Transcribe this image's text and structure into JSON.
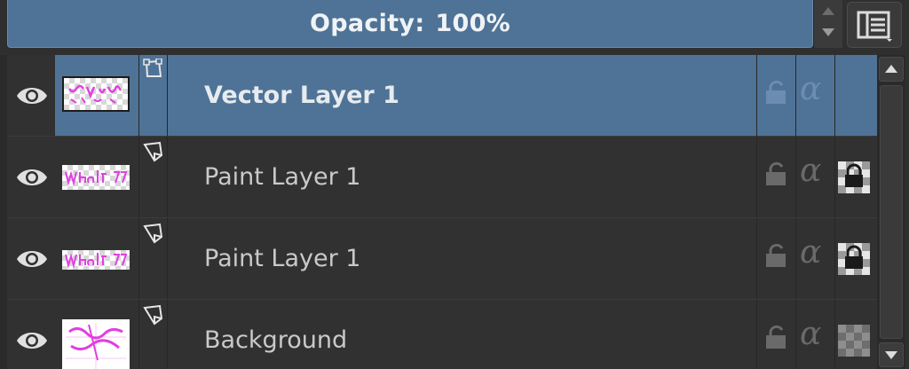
{
  "opacity": {
    "label": "Opacity:",
    "value": "100%"
  },
  "layers": [
    {
      "name": "Vector Layer 1",
      "type": "vector",
      "selected": true,
      "visible": true,
      "thumbnail": "pink-pattern"
    },
    {
      "name": "Paint Layer 1",
      "type": "paint",
      "selected": false,
      "visible": true,
      "thumbnail": "pink-text"
    },
    {
      "name": "Paint Layer 1",
      "type": "paint",
      "selected": false,
      "visible": true,
      "thumbnail": "pink-text"
    },
    {
      "name": "Background",
      "type": "paint",
      "selected": false,
      "visible": true,
      "thumbnail": "pink-strokes"
    }
  ],
  "icons": {
    "visibility": "eye-icon",
    "vector_type": "vector-shape-icon",
    "paint_type": "paint-layer-icon",
    "lock": "lock-icon",
    "alpha": "α",
    "inherit_alpha": "inherit-alpha-icon",
    "view_mode": "list-view-icon"
  },
  "colors": {
    "selection": "#4f7396",
    "panel": "#313131",
    "thumb_accent": "#e040e0"
  }
}
